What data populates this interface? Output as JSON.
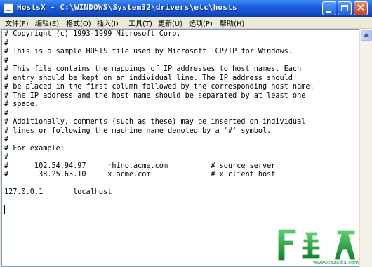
{
  "window": {
    "title": "HostsX - C:\\WINDOWS\\System32\\drivers\\etc\\hosts"
  },
  "menu": {
    "items": [
      {
        "label": "文件(F)"
      },
      {
        "label": "编辑(E)"
      },
      {
        "label": "格式(O)"
      },
      {
        "label": "插入(I)"
      },
      {
        "label": "工具(T)"
      },
      {
        "label": "更新(U)"
      },
      {
        "label": "选项(P)"
      },
      {
        "label": "帮助(H)"
      }
    ]
  },
  "editor": {
    "lines": [
      "# Copyright (c) 1993-1999 Microsoft Corp.",
      "#",
      "# This is a sample HOSTS file used by Microsoft TCP/IP for Windows.",
      "#",
      "# This file contains the mappings of IP addresses to host names. Each",
      "# entry should be kept on an individual line. The IP address should",
      "# be placed in the first column followed by the corresponding host name.",
      "# The IP address and the host name should be separated by at least one",
      "# space.",
      "#",
      "# Additionally, comments (such as these) may be inserted on individual",
      "# lines or following the machine name denoted by a '#' symbol.",
      "#",
      "# For example:",
      "#",
      "#      102.54.94.97     rhino.acme.com          # source server",
      "#       38.25.63.10     x.acme.com              # x client host",
      "",
      "127.0.0.1       localhost"
    ]
  },
  "watermark": {
    "text": "下载吧",
    "url": "www.xiazaiba.com"
  },
  "colors": {
    "titlebar": "#1d5ee0",
    "watermark_green": "#1f9a3c"
  }
}
